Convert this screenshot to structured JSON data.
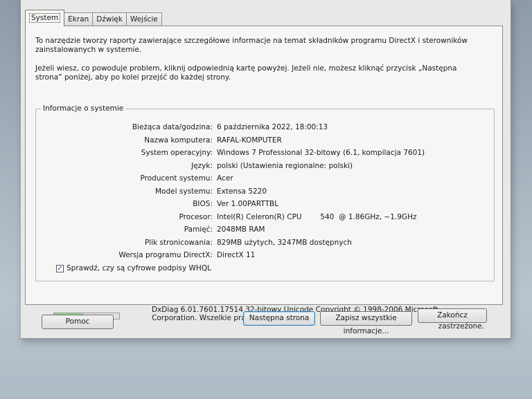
{
  "tabs": [
    {
      "label": "System",
      "active": true
    },
    {
      "label": "Ekran",
      "active": false
    },
    {
      "label": "Dźwięk",
      "active": false
    },
    {
      "label": "Wejście",
      "active": false
    }
  ],
  "intro": {
    "paragraph1": "To narzędzie tworzy raporty zawierające szczegółowe informacje na temat składników programu DirectX i sterowników zainstalowanych w systemie.",
    "paragraph2": "Jeżeli wiesz, co powoduje problem, kliknij odpowiednią kartę powyżej. Jeżeli nie, możesz kliknąć przycisk „Następna strona” poniżej, aby po kolei przejść do każdej strony."
  },
  "system_info": {
    "title": "Informacje o systemie",
    "rows": [
      {
        "label": "Bieżąca data/godzina:",
        "value": "6 października 2022, 18:00:13"
      },
      {
        "label": "Nazwa komputera:",
        "value": "RAFAL-KOMPUTER"
      },
      {
        "label": "System operacyjny:",
        "value": "Windows 7 Professional 32-bitowy (6.1, kompilacja 7601)"
      },
      {
        "label": "Język:",
        "value": "polski (Ustawienia regionalne: polski)"
      },
      {
        "label": "Producent systemu:",
        "value": "Acer"
      },
      {
        "label": "Model systemu:",
        "value": "Extensa 5220"
      },
      {
        "label": "BIOS:",
        "value": "Ver 1.00PARTTBL"
      },
      {
        "label": "Procesor:",
        "value": "Intel(R) Celeron(R) CPU        540  @ 1.86GHz, ~1.9GHz"
      },
      {
        "label": "Pamięć:",
        "value": "2048MB RAM"
      },
      {
        "label": "Plik stronicowania:",
        "value": "829MB użytych, 3247MB dostępnych"
      },
      {
        "label": "Wersja programu DirectX:",
        "value": "DirectX 11"
      }
    ]
  },
  "whql_check": {
    "label": "Sprawdź, czy są cyfrowe podpisy WHQL",
    "checked": true
  },
  "progress": {
    "fraction": 0.45
  },
  "copyright": {
    "line1": "DxDiag 6.01.7601.17514 32-bitowy Unicode  Copyright © 1998-2006 Microsoft Corporation. Wszelkie prawa",
    "line2": "zastrzeżone."
  },
  "buttons": {
    "help": "Pomoc",
    "next": "Następna strona",
    "save_all": "Zapisz wszystkie informacje...",
    "exit": "Zakończ"
  }
}
